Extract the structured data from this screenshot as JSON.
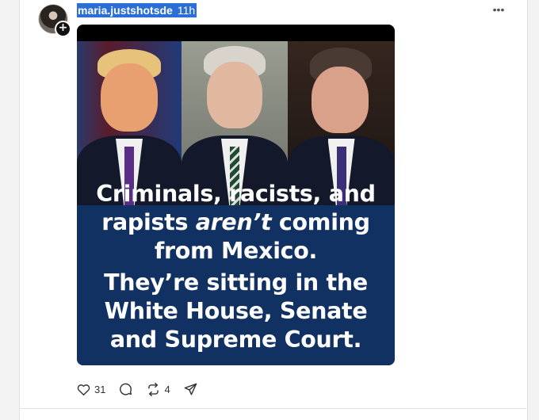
{
  "post": {
    "username": "maria.justshotsde",
    "timestamp": "11h",
    "more_icon": "more-horizontal-icon",
    "avatar_badge": "+",
    "image_caption": {
      "line1": "Criminals, racists, and",
      "line2_a": "rapists ",
      "line2_emph": "aren’t",
      "line2_b": " coming",
      "line3": "from Mexico.",
      "line4": "They’re sitting in the",
      "line5": "White House, Senate",
      "line6": "and Supreme Court."
    },
    "actions": {
      "like_count": "31",
      "repost_count": "4"
    }
  },
  "colors": {
    "selection_highlight": "#2b6fd6",
    "caption_background": "#123163"
  }
}
